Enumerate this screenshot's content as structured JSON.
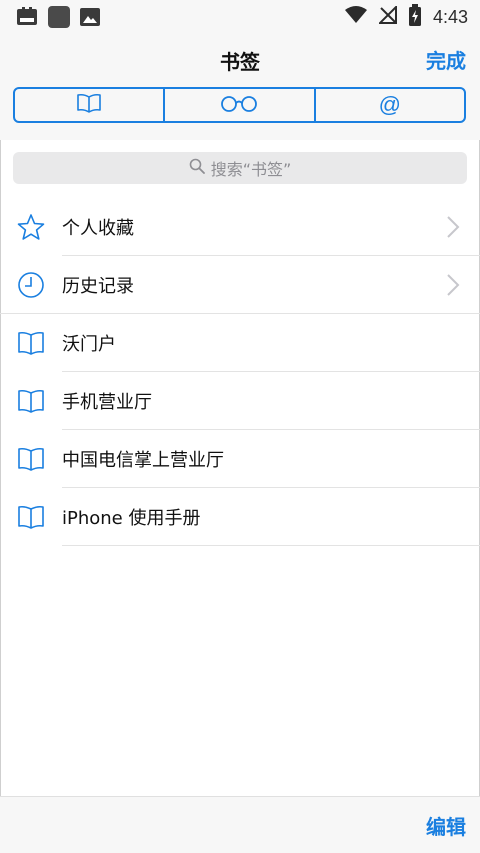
{
  "status_bar": {
    "time": "4:43"
  },
  "header": {
    "title": "书签",
    "done_label": "完成"
  },
  "segments": [
    {
      "icon": "book-icon"
    },
    {
      "icon": "reading-glasses-icon"
    },
    {
      "label": "@"
    }
  ],
  "search": {
    "placeholder": "搜索“书签”"
  },
  "list": {
    "items": [
      {
        "label": "个人收藏",
        "icon": "star-icon"
      },
      {
        "label": "历史记录",
        "icon": "clock-icon"
      },
      {
        "label": "沃门户",
        "icon": "book-icon"
      },
      {
        "label": "手机营业厅",
        "icon": "book-icon"
      },
      {
        "label": "中国电信掌上营业厅",
        "icon": "book-icon"
      },
      {
        "label": "iPhone 使用手册",
        "icon": "book-icon"
      }
    ]
  },
  "toolbar": {
    "edit_label": "编辑"
  },
  "colors": {
    "accent": "#1a7fe0",
    "background": "#f7f7f7"
  }
}
